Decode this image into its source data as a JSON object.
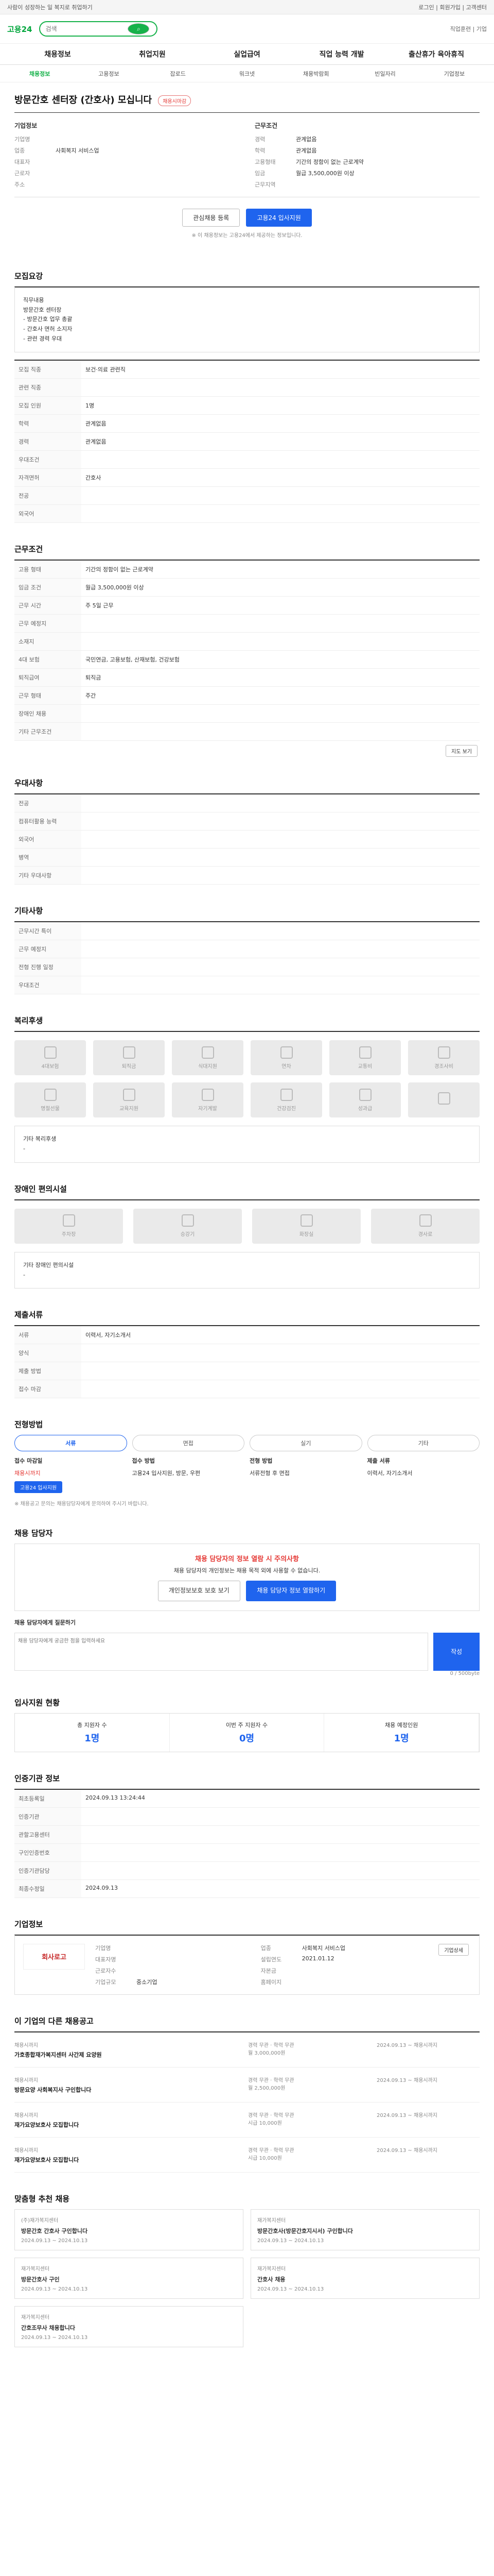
{
  "topbar": {
    "left": "사람이 성장하는 일 복지로 취업하기",
    "right": "로그인 | 회원가입 | 고객센터"
  },
  "header": {
    "logo": "고용24",
    "search_placeholder": "검색",
    "right": "직업훈련 | 기업"
  },
  "gnb": [
    "채용정보",
    "취업지원",
    "실업급여",
    "직업 능력 개발",
    "출산휴가 육아휴직"
  ],
  "subnav": [
    "채용정보",
    "고용정보",
    "잡로드",
    "워크넷",
    "채용박람회",
    "빈일자리",
    "기업정보"
  ],
  "job": {
    "title": "방문간호 센터장 (간호사) 모십니다",
    "status": "채용시마감",
    "company_label": "기업정보",
    "company_rows": [
      [
        "기업명",
        ""
      ],
      [
        "업종",
        "사회복지 서비스업"
      ],
      [
        "대표자",
        ""
      ],
      [
        "근로자",
        ""
      ],
      [
        "주소",
        ""
      ]
    ],
    "work_label": "근무조건",
    "work_rows": [
      [
        "경력",
        "관계없음"
      ],
      [
        "학력",
        "관계없음"
      ],
      [
        "고용형태",
        "기간의 정함이 없는 근로계약"
      ],
      [
        "임금",
        "월급 3,500,000원 이상"
      ],
      [
        "근무지역",
        ""
      ]
    ],
    "bookmark_btn": "관심채용 등록",
    "apply_btn": "고용24 입사지원",
    "notice": "※ 이 채용정보는 고용24에서 제공하는 정보입니다."
  },
  "recruit": {
    "title": "모집요강",
    "body": [
      "직무내용",
      "방문간호 센터장",
      "- 방문간호 업무 총괄",
      "- 간호사 면허 소지자",
      "- 관련 경력 우대"
    ],
    "rows": [
      [
        "모집 직종",
        "보건·의료 관련직"
      ],
      [
        "관련 직종",
        ""
      ],
      [
        "모집 인원",
        "1명"
      ],
      [
        "학력",
        "관계없음"
      ],
      [
        "경력",
        "관계없음"
      ],
      [
        "우대조건",
        ""
      ],
      [
        "자격면허",
        "간호사"
      ],
      [
        "전공",
        ""
      ],
      [
        "외국어",
        ""
      ]
    ]
  },
  "cond": {
    "title": "근무조건",
    "rows": [
      [
        "고용 형태",
        "기간의 정함이 없는 근로계약"
      ],
      [
        "임금 조건",
        "월급 3,500,000원 이상"
      ],
      [
        "근무 시간",
        "주 5일 근무"
      ],
      [
        "근무 예정지",
        ""
      ],
      [
        "소재지",
        ""
      ],
      [
        "4대 보험",
        "국민연금, 고용보험, 산재보험, 건강보험"
      ],
      [
        "퇴직급여",
        "퇴직금"
      ],
      [
        "근무 형태",
        "주간"
      ],
      [
        "장애인 채용",
        ""
      ],
      [
        "기타 근무조건",
        ""
      ]
    ],
    "map_btn": "지도 보기"
  },
  "special": {
    "title": "우대사항",
    "rows": [
      [
        "전공",
        ""
      ],
      [
        "컴퓨터활용 능력",
        ""
      ],
      [
        "외국어",
        ""
      ],
      [
        "병역",
        ""
      ],
      [
        "기타 우대사항",
        ""
      ]
    ]
  },
  "etc": {
    "title": "기타사항",
    "rows": [
      [
        "근무시간 특이",
        ""
      ],
      [
        "근무 예정지",
        ""
      ],
      [
        "전형 진행 일정",
        ""
      ],
      [
        "우대조건",
        ""
      ]
    ]
  },
  "welfare": {
    "title": "복리후생",
    "tiles": [
      "4대보험",
      "퇴직금",
      "식대지원",
      "연차",
      "교통비",
      "경조사비",
      "명절선물",
      "교육지원",
      "자기계발",
      "건강검진",
      "성과급",
      ""
    ],
    "etc_label": "기타 복리후생",
    "etc_value": "-"
  },
  "disability": {
    "title": "장애인 편의시설",
    "tiles": [
      "주차장",
      "승강기",
      "화장실",
      "경사로"
    ],
    "etc_label": "기타 장애인 편의시설",
    "etc_value": "-"
  },
  "docs": {
    "title": "제출서류",
    "rows": [
      [
        "서류",
        "이력서, 자기소개서"
      ],
      [
        "양식",
        ""
      ],
      [
        "제출 방법",
        ""
      ],
      [
        "접수 마감",
        ""
      ]
    ]
  },
  "method": {
    "title": "전형방법",
    "tabs": [
      "서류",
      "면접",
      "실기",
      "기타"
    ],
    "cols": [
      {
        "h": "접수 마감일",
        "v": "채용시까지",
        "extra": "고용24 입사지원"
      },
      {
        "h": "접수 방법",
        "v": "고용24 입사지원, 방문, 우편",
        "extra": ""
      },
      {
        "h": "전형 방법",
        "v": "서류전형 후 면접",
        "extra": ""
      },
      {
        "h": "제출 서류",
        "v": "이력서, 자기소개서",
        "extra": ""
      }
    ],
    "notes": "※ 채용공고 문의는 채용담당자에게 문의하여 주시기 바랍니다."
  },
  "contact": {
    "title": "채용 담당자",
    "alert_title": "채용 담당자의 정보 열람 시 주의사항",
    "alert_body": "채용 담당자의 개인정보는 채용 목적 외에 사용할 수 없습니다.",
    "btn1": "개인정보보호 보호 보기",
    "btn2": "채용 담당자 정보 열람하기",
    "qa_label": "채용 담당자에게 질문하기",
    "qa_placeholder": "채용 담당자에게 궁금한 점을 입력하세요",
    "qa_btn": "작성",
    "counter": "0 / 500byte"
  },
  "stats": {
    "title": "입사지원 현황",
    "items": [
      [
        "총 지원자 수",
        "1명"
      ],
      [
        "이번 주 지원자 수",
        "0명"
      ],
      [
        "채용 예정인원",
        "1명"
      ]
    ]
  },
  "manage": {
    "title": "인증기관 정보",
    "rows": [
      [
        "최초등록일",
        "2024.09.13 13:24:44"
      ],
      [
        "인증기관",
        ""
      ],
      [
        "관할고용센터",
        ""
      ],
      [
        "구인인증번호",
        ""
      ],
      [
        "인증기관담당",
        ""
      ],
      [
        "최종수정일",
        "2024.09.13"
      ]
    ]
  },
  "company": {
    "title": "기업정보",
    "logo_text": "회사로고",
    "rows": [
      [
        "기업명",
        ""
      ],
      [
        "업종",
        "사회복지 서비스업"
      ],
      [
        "대표자명",
        ""
      ],
      [
        "설립연도",
        "2021.01.12"
      ],
      [
        "근로자수",
        ""
      ],
      [
        "자본금",
        ""
      ],
      [
        "기업규모",
        "중소기업"
      ],
      [
        "홈페이지",
        ""
      ]
    ],
    "btn": "기업상세"
  },
  "others": {
    "title": "이 기업의 다른 채용공고",
    "jobs": [
      {
        "tag": "채용시까지",
        "name": "가호종합재가복지센터 사간제 요양원",
        "meta": "경력 무관 · 학력 무관",
        "pay": "월 3,000,000원",
        "date": "2024.09.13 ~ 채용시까지"
      },
      {
        "tag": "채용시까지",
        "name": "방문요양 사회복지사 구인합니다",
        "meta": "경력 무관 · 학력 무관",
        "pay": "월 2,500,000원",
        "date": "2024.09.13 ~ 채용시까지"
      },
      {
        "tag": "채용시까지",
        "name": "재가요양보호사 모집합니다",
        "meta": "경력 무관 · 학력 무관",
        "pay": "시급 10,000원",
        "date": "2024.09.13 ~ 채용시까지"
      },
      {
        "tag": "채용시까지",
        "name": "재가요양보호사 모집합니다",
        "meta": "경력 무관 · 학력 무관",
        "pay": "시급 10,000원",
        "date": "2024.09.13 ~ 채용시까지"
      }
    ]
  },
  "recommend": {
    "title": "맞춤형 추천 채용",
    "cards": [
      {
        "co": "(주)재가복지센터",
        "name": "방문간호 간호사 구인합니다",
        "date": "2024.09.13 ~ 2024.10.13"
      },
      {
        "co": "재가복지센터",
        "name": "방문간호사(방문간호지시서) 구인합니다",
        "date": "2024.09.13 ~ 2024.10.13"
      },
      {
        "co": "재가복지센터",
        "name": "방문간호사 구인",
        "date": "2024.09.13 ~ 2024.10.13"
      },
      {
        "co": "재가복지센터",
        "name": "간호사 채용",
        "date": "2024.09.13 ~ 2024.10.13"
      },
      {
        "co": "재가복지센터",
        "name": "간호조무사 채용합니다",
        "date": "2024.09.13 ~ 2024.10.13"
      }
    ]
  }
}
